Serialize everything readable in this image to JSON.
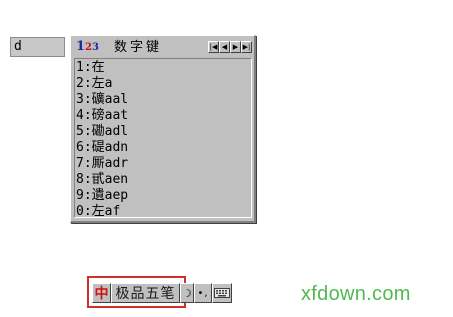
{
  "composition": {
    "text": "d"
  },
  "candidate_window": {
    "title": "数字键",
    "logo_digits": [
      "1",
      "2",
      "3"
    ],
    "nav_buttons": [
      "first-page",
      "prev-page",
      "next-page",
      "last-page"
    ],
    "nav_glyphs": [
      "|◀",
      "◀",
      "▶",
      "▶|"
    ],
    "items": [
      "1:在",
      "2:左a",
      "3:礦aal",
      "4:磅aat",
      "5:磡adl",
      "6:碮adn",
      "7:厮adr",
      "8:甙aen",
      "9:遺aep",
      "0:左af"
    ]
  },
  "status_bar": {
    "mode_icon_text": "中",
    "ime_name": "极品五笔",
    "moon_glyph": "☽",
    "punct_glyph": "•,",
    "keyboard_icon": "keyboard-icon"
  },
  "watermark": {
    "text": "xfdown.com",
    "color": "#4fba52"
  },
  "colors": {
    "highlight_border": "#d0302c",
    "window_bg": "#c0c0c0"
  }
}
